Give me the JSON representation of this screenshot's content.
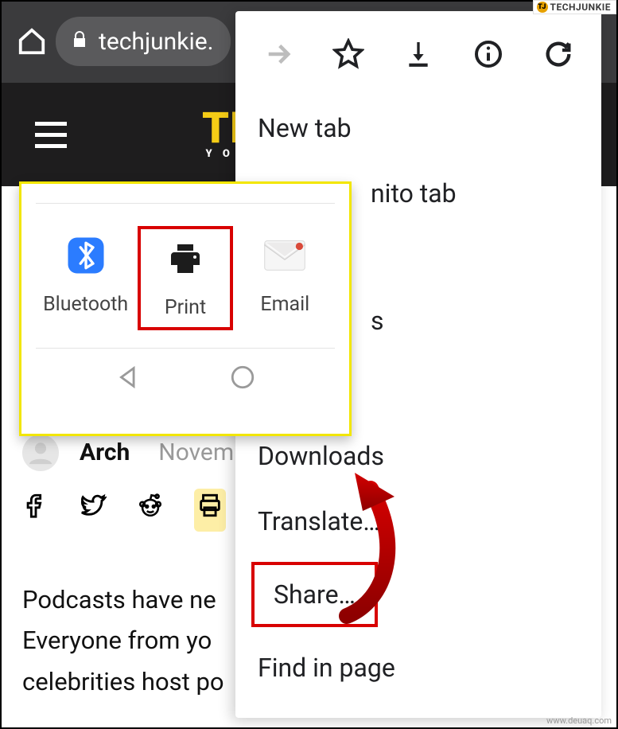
{
  "chrome": {
    "url_display": "techjunkie."
  },
  "header": {
    "logo_text": "TE",
    "logo_sub": "Y O U"
  },
  "byline": {
    "author": "Arch",
    "date_partial": "Novem"
  },
  "article": {
    "line1_partial": "Podcasts have ne",
    "line2_partial": "Everyone from yo",
    "line3_partial": "celebrities host po"
  },
  "menu": {
    "new_tab": "New tab",
    "incognito_partial": "nito tab",
    "downloads": "Downloads",
    "translate": "Translate…",
    "share": "Share…",
    "find": "Find in page",
    "stray_s": "s"
  },
  "share_sheet": {
    "bluetooth": "Bluetooth",
    "print": "Print",
    "email": "Email"
  },
  "watermark_top": "TECHJUNKIE",
  "watermark_bottom": "www.deuaq.com"
}
